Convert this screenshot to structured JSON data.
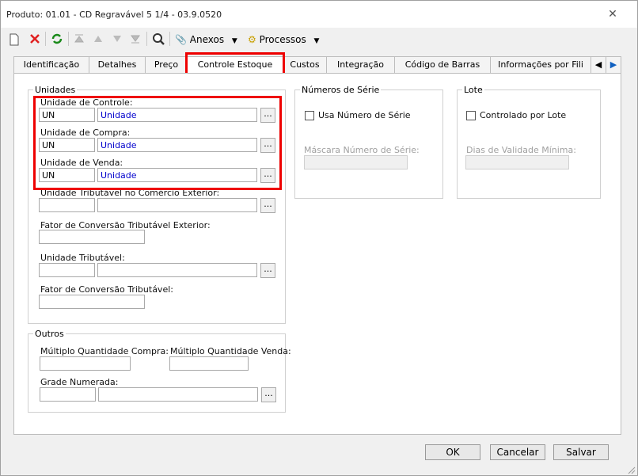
{
  "window": {
    "title": "Produto: 01.01 - CD Regravável 5 1/4 - 03.9.0520"
  },
  "toolbar": {
    "anexos": "Anexos",
    "processos": "Processos"
  },
  "tabs": [
    "Identificação",
    "Detalhes",
    "Preço",
    "Controle Estoque",
    "Custos",
    "Integração",
    "Código de Barras",
    "Informações por Fili"
  ],
  "unidades": {
    "legend": "Unidades",
    "controle_label": "Unidade de Controle:",
    "controle_code": "UN",
    "controle_desc": "Unidade",
    "compra_label": "Unidade de Compra:",
    "compra_code": "UN",
    "compra_desc": "Unidade",
    "venda_label": "Unidade de Venda:",
    "venda_code": "UN",
    "venda_desc": "Unidade",
    "trib_ext_label": "Unidade Tributável no Comércio Exterior:",
    "fator_ext_label": "Fator de Conversão Tributável Exterior:",
    "trib_label": "Unidade Tributável:",
    "fator_label": "Fator de Conversão Tributável:",
    "ellipsis": "..."
  },
  "outros": {
    "legend": "Outros",
    "mult_compra": "Múltiplo Quantidade Compra:",
    "mult_venda": "Múltiplo Quantidade Venda:",
    "grade": "Grade Numerada:"
  },
  "serie": {
    "legend": "Números de Série",
    "usa": "Usa Número de Série",
    "mascara": "Máscara Número de Série:"
  },
  "lote": {
    "legend": "Lote",
    "controlado": "Controlado por Lote",
    "dias": "Dias de Validade Mínima:"
  },
  "buttons": {
    "ok": "OK",
    "cancel": "Cancelar",
    "save": "Salvar"
  }
}
